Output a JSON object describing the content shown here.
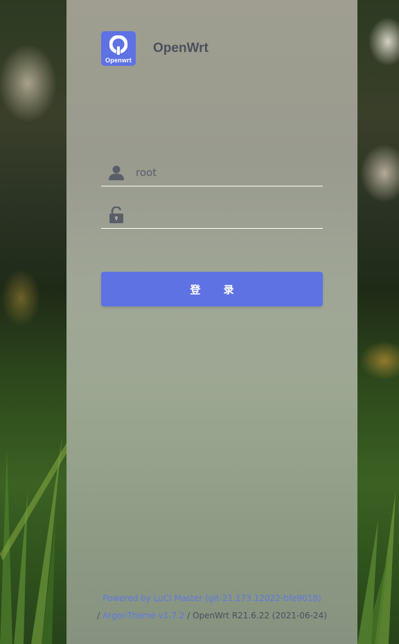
{
  "brand": {
    "logo_text": "Openwrt",
    "title": "OpenWrt"
  },
  "login": {
    "username_value": "root",
    "password_value": "",
    "submit_label": "登 录"
  },
  "footer": {
    "powered_by": "Powered by LuCI Master (git-21.173.12022-bfe9018)",
    "separator": "/",
    "theme_link": "ArgonTheme v1.7.2",
    "version_text": "/ OpenWrt R21.6.22 (2021-06-24)"
  },
  "icons": {
    "user": "user-icon",
    "lock": "unlock-icon"
  },
  "colors": {
    "accent": "#5e72e4",
    "icon": "#5a5e6a",
    "link": "#6176e8",
    "text": "#4b4f5c"
  }
}
